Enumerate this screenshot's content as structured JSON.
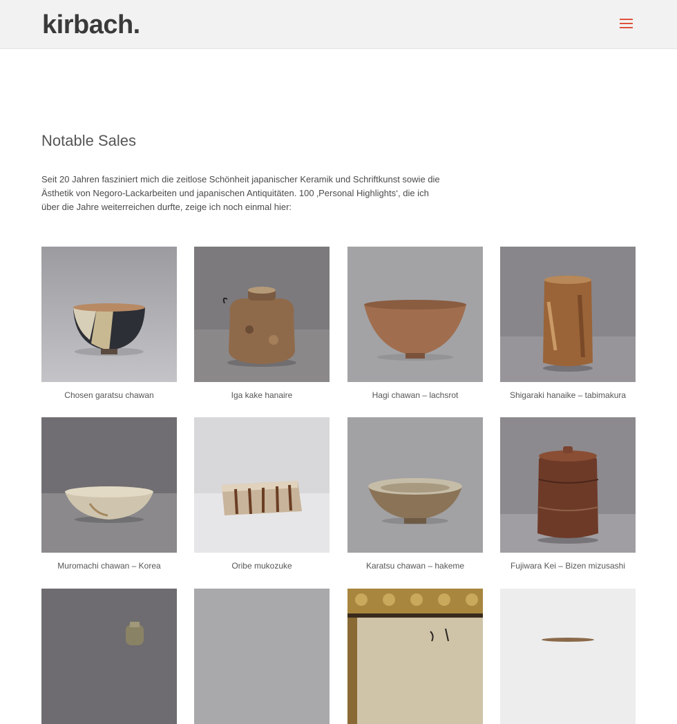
{
  "header": {
    "logo": "kirbach."
  },
  "page": {
    "title": "Notable Sales",
    "intro": "Seit 20 Jahren fasziniert mich die zeitlose Schönheit japanischer Keramik und Schriftkunst sowie die Ästhetik von Negoro-Lackarbeiten und japanischen Antiquitäten. 100 ‚Personal Highlights‘, die ich über die Jahre weiterreichen durfte, zeige ich noch einmal hier:"
  },
  "items": [
    {
      "caption": "Chosen garatsu chawan"
    },
    {
      "caption": "Iga kake hanaire"
    },
    {
      "caption": "Hagi chawan – lachsrot"
    },
    {
      "caption": "Shigaraki hanaike – tabimakura"
    },
    {
      "caption": "Muromachi chawan – Korea"
    },
    {
      "caption": "Oribe mukozuke"
    },
    {
      "caption": "Karatsu chawan – hakeme"
    },
    {
      "caption": "Fujiwara Kei – Bizen mizusashi"
    },
    {
      "caption": ""
    },
    {
      "caption": ""
    },
    {
      "caption": ""
    },
    {
      "caption": ""
    }
  ],
  "colors": {
    "accent": "#e0523a",
    "header_bg": "#f2f2f2",
    "text": "#555555"
  }
}
